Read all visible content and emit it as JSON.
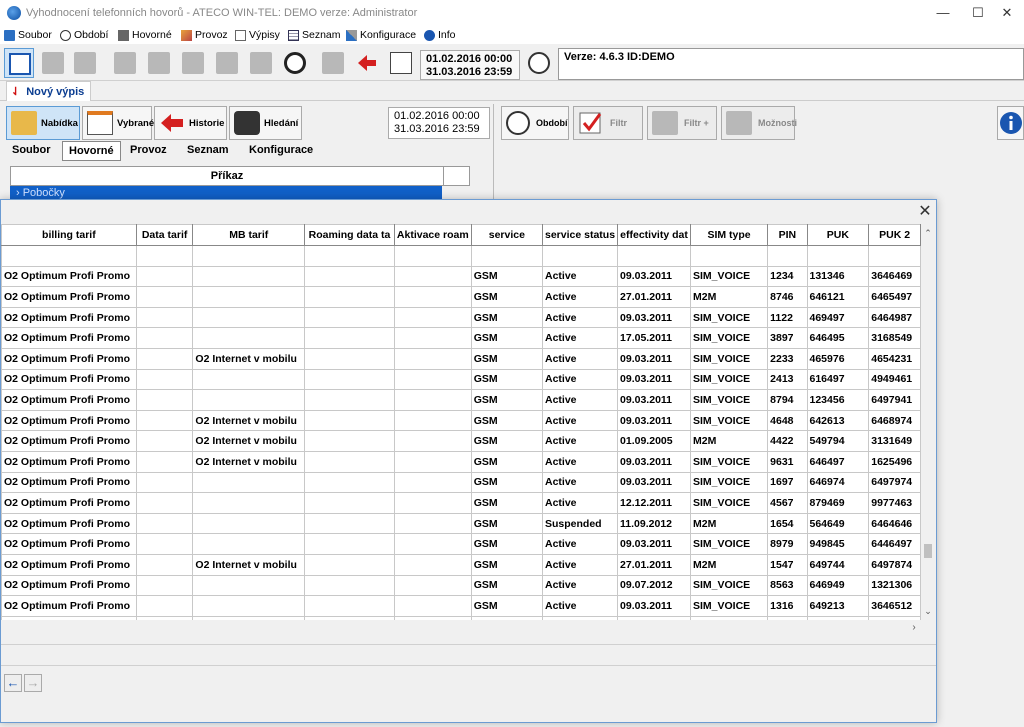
{
  "window": {
    "title": "Vyhodnocení telefonních hovorů - ATECO WIN-TEL: DEMO verze: Administrator",
    "minimize": "—",
    "maximize": "☐",
    "close": "✕"
  },
  "menu": {
    "items": [
      {
        "label": "Soubor",
        "icon": "folder-icon"
      },
      {
        "label": "Období",
        "icon": "clock-icon"
      },
      {
        "label": "Hovorné",
        "icon": "calculator-icon"
      },
      {
        "label": "Provoz",
        "icon": "pen-icon"
      },
      {
        "label": "Výpisy",
        "icon": "checklist-icon"
      },
      {
        "label": "Seznam",
        "icon": "table-icon"
      },
      {
        "label": "Konfigurace",
        "icon": "config-icon"
      },
      {
        "label": "Info",
        "icon": "info-icon"
      }
    ]
  },
  "toolbar": {
    "date_from": "01.02.2016 00:00",
    "date_to": "31.03.2016 23:59",
    "version": "Verze: 4.6.3 ID:DEMO"
  },
  "doc_tab": {
    "pin": "⇃",
    "label": "Nový výpis"
  },
  "left_panel": {
    "buttons": [
      {
        "label": "Nabídka"
      },
      {
        "label": "Vybrané"
      },
      {
        "label": "Historie"
      },
      {
        "label": "Hledání"
      }
    ],
    "date_from": "01.02.2016 00:00",
    "date_to": "31.03.2016 23:59",
    "tabs": [
      "Soubor",
      "Hovorné",
      "Provoz",
      "Seznam",
      "Konfigurace"
    ],
    "list_header": "Příkaz",
    "first_row": "› Pobočky"
  },
  "right_panel": {
    "buttons": [
      {
        "label": "Období"
      },
      {
        "label": "Filtr"
      },
      {
        "label": "Filtr +"
      },
      {
        "label": "Možnosti"
      }
    ]
  },
  "dialog": {
    "close": "✕",
    "columns": [
      "billing tarif",
      "Data tarif",
      "MB tarif",
      "Roaming data ta",
      "Aktivace roam",
      "service",
      "service status",
      "effectivity dat",
      "SIM type",
      "PIN",
      "PUK",
      "PUK 2"
    ],
    "rows": [
      [
        "",
        "",
        "",
        "",
        "",
        "",
        "",
        "",
        "",
        "",
        "",
        ""
      ],
      [
        "O2 Optimum Profi Promo",
        "",
        "",
        "",
        "",
        "GSM",
        "Active",
        "09.03.2011",
        "SIM_VOICE",
        "1234",
        "131346",
        "3646469"
      ],
      [
        "O2 Optimum Profi Promo",
        "",
        "",
        "",
        "",
        "GSM",
        "Active",
        "27.01.2011",
        "M2M",
        "8746",
        "646121",
        "6465497"
      ],
      [
        "O2 Optimum Profi Promo",
        "",
        "",
        "",
        "",
        "GSM",
        "Active",
        "09.03.2011",
        "SIM_VOICE",
        "1122",
        "469497",
        "6464987"
      ],
      [
        "O2 Optimum Profi Promo",
        "",
        "",
        "",
        "",
        "GSM",
        "Active",
        "17.05.2011",
        "SIM_VOICE",
        "3897",
        "646495",
        "3168549"
      ],
      [
        "O2 Optimum Profi Promo",
        "",
        "O2 Internet v mobilu",
        "",
        "",
        "GSM",
        "Active",
        "09.03.2011",
        "SIM_VOICE",
        "2233",
        "465976",
        "4654231"
      ],
      [
        "O2 Optimum Profi Promo",
        "",
        "",
        "",
        "",
        "GSM",
        "Active",
        "09.03.2011",
        "SIM_VOICE",
        "2413",
        "616497",
        "4949461"
      ],
      [
        "O2 Optimum Profi Promo",
        "",
        "",
        "",
        "",
        "GSM",
        "Active",
        "09.03.2011",
        "SIM_VOICE",
        "8794",
        "123456",
        "6497941"
      ],
      [
        "O2 Optimum Profi Promo",
        "",
        "O2 Internet v mobilu",
        "",
        "",
        "GSM",
        "Active",
        "09.03.2011",
        "SIM_VOICE",
        "4648",
        "642613",
        "6468974"
      ],
      [
        "O2 Optimum Profi Promo",
        "",
        "O2 Internet v mobilu",
        "",
        "",
        "GSM",
        "Active",
        "01.09.2005",
        "M2M",
        "4422",
        "549794",
        "3131649"
      ],
      [
        "O2 Optimum Profi Promo",
        "",
        "O2 Internet v mobilu",
        "",
        "",
        "GSM",
        "Active",
        "09.03.2011",
        "SIM_VOICE",
        "9631",
        "646497",
        "1625496"
      ],
      [
        "O2 Optimum Profi Promo",
        "",
        "",
        "",
        "",
        "GSM",
        "Active",
        "09.03.2011",
        "SIM_VOICE",
        "1697",
        "646974",
        "6497974"
      ],
      [
        "O2 Optimum Profi Promo",
        "",
        "",
        "",
        "",
        "GSM",
        "Active",
        "12.12.2011",
        "SIM_VOICE",
        "4567",
        "879469",
        "9977463"
      ],
      [
        "O2 Optimum Profi Promo",
        "",
        "",
        "",
        "",
        "GSM",
        "Suspended",
        "11.09.2012",
        "M2M",
        "1654",
        "564649",
        "6464646"
      ],
      [
        "O2 Optimum Profi Promo",
        "",
        "",
        "",
        "",
        "GSM",
        "Active",
        "09.03.2011",
        "SIM_VOICE",
        "8979",
        "949845",
        "6446497"
      ],
      [
        "O2 Optimum Profi Promo",
        "",
        "O2 Internet v mobilu",
        "",
        "",
        "GSM",
        "Active",
        "27.01.2011",
        "M2M",
        "1547",
        "649744",
        "6497874"
      ],
      [
        "O2 Optimum Profi Promo",
        "",
        "",
        "",
        "",
        "GSM",
        "Active",
        "09.07.2012",
        "SIM_VOICE",
        "8563",
        "646949",
        "1321306"
      ],
      [
        "O2 Optimum Profi Promo",
        "",
        "",
        "",
        "",
        "GSM",
        "Active",
        "09.03.2011",
        "SIM_VOICE",
        "1316",
        "649213",
        "3646512"
      ],
      [
        "",
        "",
        "",
        "",
        "",
        "",
        "",
        "",
        "",
        "",
        "",
        ""
      ]
    ],
    "nav_back": "←",
    "nav_forward": "→"
  }
}
